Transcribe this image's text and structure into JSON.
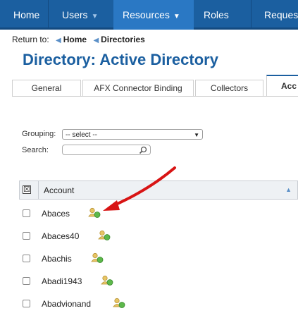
{
  "nav": {
    "items": [
      {
        "label": "Home",
        "caret": false,
        "active": false
      },
      {
        "label": "Users",
        "caret": true,
        "active": false
      },
      {
        "label": "Resources",
        "caret": true,
        "active": true
      },
      {
        "label": "Roles",
        "caret": false,
        "active": false
      },
      {
        "label": "Reques",
        "caret": false,
        "active": false
      }
    ]
  },
  "breadcrumb": {
    "prefix": "Return to:",
    "links": [
      "Home",
      "Directories"
    ]
  },
  "page_title": "Directory: Active Directory",
  "tabs": [
    {
      "label": "General",
      "active": false
    },
    {
      "label": "AFX Connector Binding",
      "active": false
    },
    {
      "label": "Collectors",
      "active": false
    },
    {
      "label": "Acc",
      "active": true
    }
  ],
  "filters": {
    "grouping_label": "Grouping:",
    "grouping_value": "-- select --",
    "search_label": "Search:",
    "search_value": ""
  },
  "grid": {
    "column_header": "Account",
    "header_check": "☒",
    "sort": "ascending",
    "rows": [
      {
        "account": "Abaces"
      },
      {
        "account": "Abaces40"
      },
      {
        "account": "Abachis"
      },
      {
        "account": "Abadi1943"
      },
      {
        "account": "Abadvionand"
      }
    ]
  },
  "colors": {
    "nav_bg": "#1b5fa0",
    "nav_active": "#2a78c4",
    "title": "#1b5fa0",
    "annotation_arrow": "#d81414"
  },
  "icons": {
    "row_icon": "user-account-icon",
    "search": "search-icon",
    "nav_caret": "caret-down-icon",
    "breadcrumb_arrow": "triangle-left-icon"
  }
}
